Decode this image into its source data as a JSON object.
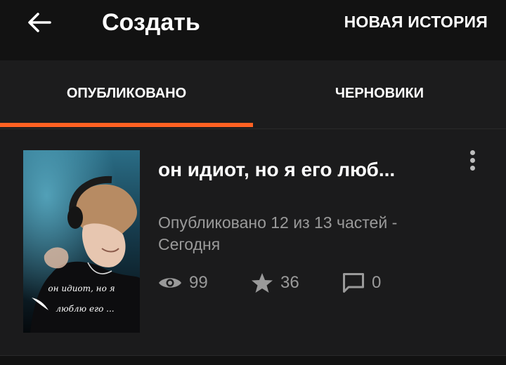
{
  "header": {
    "back_icon": "arrow-left-icon",
    "title": "Создать",
    "new_story_label": "НОВАЯ ИСТОРИЯ"
  },
  "tabs": [
    {
      "label": "ОПУБЛИКОВАНО",
      "active": true
    },
    {
      "label": "ЧЕРНОВИКИ",
      "active": false
    }
  ],
  "story": {
    "title": "он идиот, но я его люб...",
    "cover_caption_line1": "он идиот, но я",
    "cover_caption_line2": "люблю его ...",
    "status_line1": "Опубликовано 12 из 13 частей -",
    "status_line2": "Сегодня",
    "views": "99",
    "votes": "36",
    "comments": "0",
    "icons": {
      "views": "eye-icon",
      "votes": "star-icon",
      "comments": "comment-icon",
      "menu": "more-vertical-icon"
    }
  },
  "colors": {
    "background": "#121212",
    "card": "#1b1b1c",
    "accent": "#ff6122",
    "secondary_text": "#9a9a9a"
  }
}
